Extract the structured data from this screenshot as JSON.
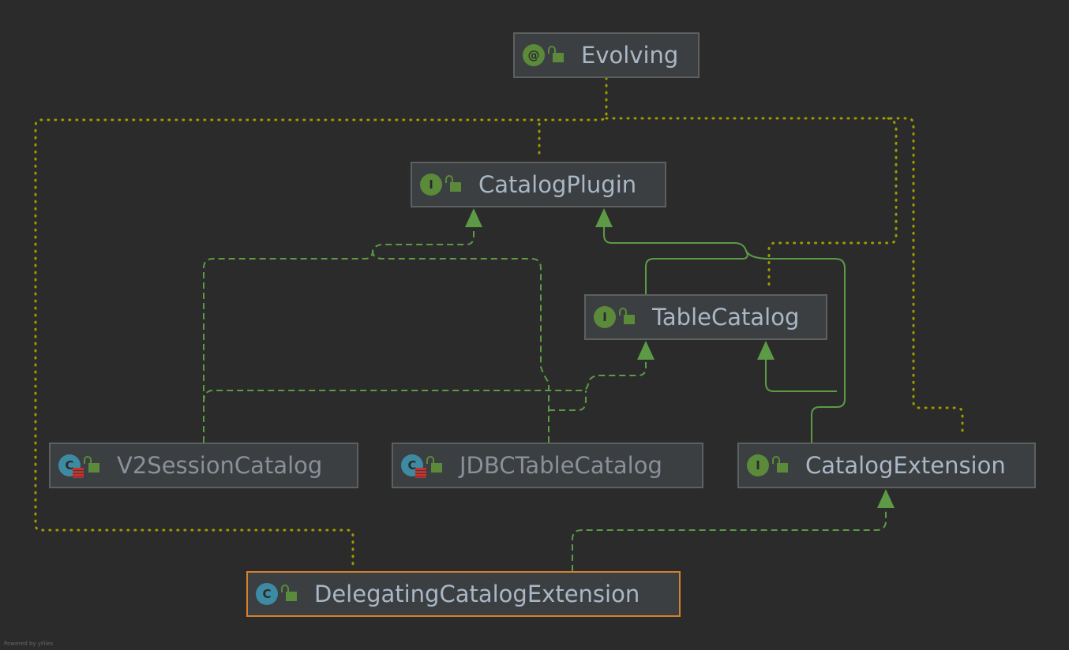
{
  "nodes": {
    "evolving": {
      "label": "Evolving",
      "icon": "annotation-icon",
      "icon_glyph": "@"
    },
    "catalog_plugin": {
      "label": "CatalogPlugin",
      "icon": "interface-icon",
      "icon_glyph": "I"
    },
    "table_catalog": {
      "label": "TableCatalog",
      "icon": "interface-icon",
      "icon_glyph": "I"
    },
    "v2_session_catalog": {
      "label": "V2SessionCatalog",
      "icon": "class-icon",
      "icon_glyph": "C"
    },
    "jdbc_table_catalog": {
      "label": "JDBCTableCatalog",
      "icon": "class-icon",
      "icon_glyph": "C"
    },
    "catalog_extension": {
      "label": "CatalogExtension",
      "icon": "interface-icon",
      "icon_glyph": "I"
    },
    "delegating_catalog_extension": {
      "label": "DelegatingCatalogExtension",
      "icon": "class-icon",
      "icon_glyph": "C",
      "selected": true
    }
  },
  "colors": {
    "annotation_edge": "#9c9c00",
    "extends_edge": "#5c9a46",
    "selection": "#d4812e"
  },
  "footer": "Powered by yFiles"
}
